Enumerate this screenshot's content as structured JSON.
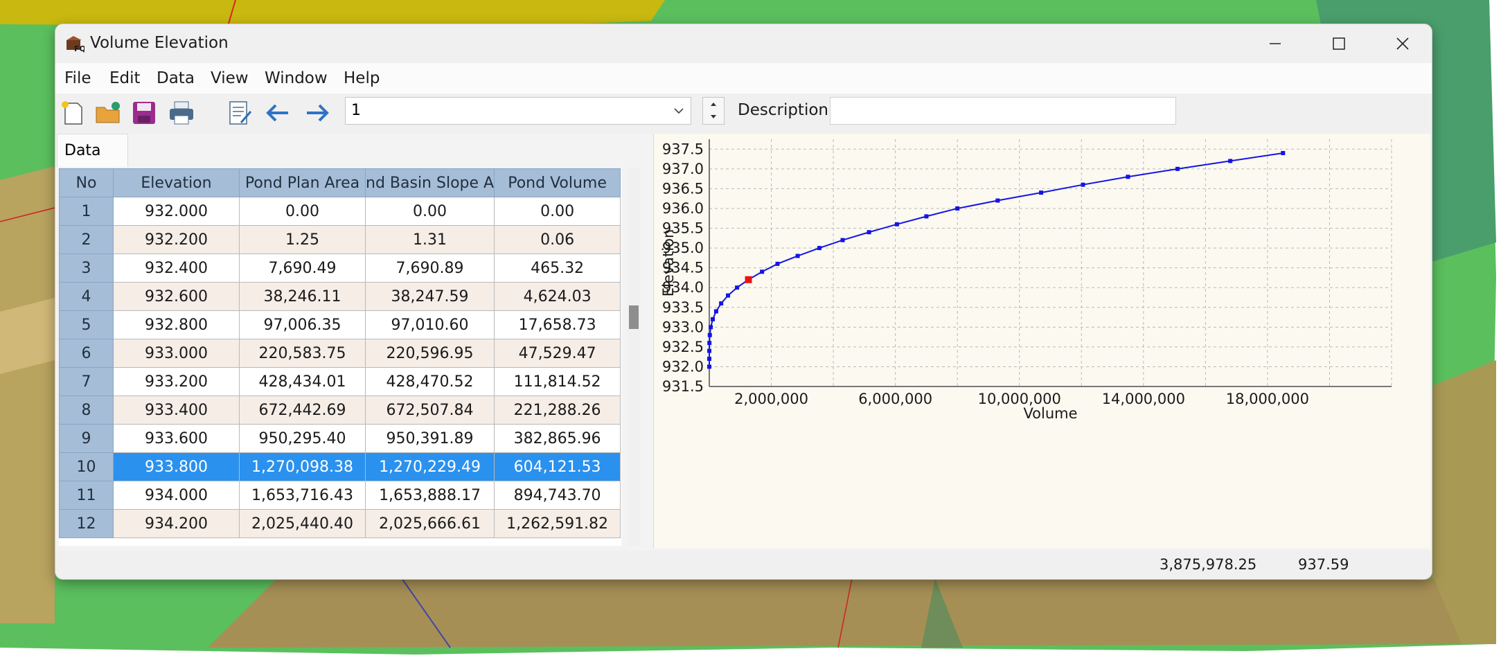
{
  "window": {
    "title": "Volume Elevation"
  },
  "menu": [
    "File",
    "Edit",
    "Data",
    "View",
    "Window",
    "Help"
  ],
  "toolbar": {
    "icons": [
      "new-file-icon",
      "open-folder-icon",
      "save-icon",
      "print-icon",
      "edit-notes-icon",
      "arrow-left-icon",
      "arrow-right-icon"
    ],
    "record_value": "1",
    "description_label": "Description",
    "description_value": ""
  },
  "tab": {
    "label": "Data"
  },
  "table": {
    "columns": [
      "No",
      "Elevation",
      "Pond Plan Area",
      "nd Basin Slope A",
      "Pond Volume"
    ],
    "selected_row": 10,
    "rows": [
      [
        "1",
        "932.000",
        "0.00",
        "0.00",
        "0.00"
      ],
      [
        "2",
        "932.200",
        "1.25",
        "1.31",
        "0.06"
      ],
      [
        "3",
        "932.400",
        "7,690.49",
        "7,690.89",
        "465.32"
      ],
      [
        "4",
        "932.600",
        "38,246.11",
        "38,247.59",
        "4,624.03"
      ],
      [
        "5",
        "932.800",
        "97,006.35",
        "97,010.60",
        "17,658.73"
      ],
      [
        "6",
        "933.000",
        "220,583.75",
        "220,596.95",
        "47,529.47"
      ],
      [
        "7",
        "933.200",
        "428,434.01",
        "428,470.52",
        "111,814.52"
      ],
      [
        "8",
        "933.400",
        "672,442.69",
        "672,507.84",
        "221,288.26"
      ],
      [
        "9",
        "933.600",
        "950,295.40",
        "950,391.89",
        "382,865.96"
      ],
      [
        "10",
        "933.800",
        "1,270,098.38",
        "1,270,229.49",
        "604,121.53"
      ],
      [
        "11",
        "934.000",
        "1,653,716.43",
        "1,653,888.17",
        "894,743.70"
      ],
      [
        "12",
        "934.200",
        "2,025,440.40",
        "2,025,666.61",
        "1,262,591.82"
      ]
    ]
  },
  "chart_data": {
    "type": "line",
    "xlabel": "Volume",
    "ylabel": "Elevation",
    "xlim": [
      0,
      22000000
    ],
    "ylim": [
      931.5,
      937.75
    ],
    "x_ticks": [
      2000000,
      6000000,
      10000000,
      14000000,
      18000000
    ],
    "x_tick_labels": [
      "2,000,000",
      "6,000,000",
      "10,000,000",
      "14,000,000",
      "18,000,000"
    ],
    "y_ticks": [
      931.5,
      932.0,
      932.5,
      933.0,
      933.5,
      934.0,
      934.5,
      935.0,
      935.5,
      936.0,
      936.5,
      937.0,
      937.5
    ],
    "y_tick_labels": [
      "931.5",
      "932.0",
      "932.5",
      "933.0",
      "933.5",
      "934.0",
      "934.5",
      "935.0",
      "935.5",
      "936.0",
      "936.5",
      "937.0",
      "937.5"
    ],
    "grid": true,
    "line_color": "#1414e6",
    "highlight_color": "#ee1111",
    "highlight_index": 11,
    "series": [
      {
        "x": [
          0,
          60,
          465,
          4624,
          17659,
          47529,
          111815,
          221288,
          382866,
          604122,
          894744,
          1262592,
          1700000,
          2200000,
          2850000,
          3550000,
          4300000,
          5150000,
          6050000,
          7000000,
          8000000,
          9300000,
          10700000,
          12050000,
          13500000,
          15100000,
          16800000,
          18500000
        ],
        "y": [
          932.0,
          932.2,
          932.4,
          932.6,
          932.8,
          933.0,
          933.2,
          933.4,
          933.6,
          933.8,
          934.0,
          934.2,
          934.4,
          934.6,
          934.8,
          935.0,
          935.2,
          935.4,
          935.6,
          935.8,
          936.0,
          936.2,
          936.4,
          936.6,
          936.8,
          937.0,
          937.2,
          937.4
        ]
      }
    ]
  },
  "status": {
    "volume": "3,875,978.25",
    "elevation": "937.59"
  }
}
